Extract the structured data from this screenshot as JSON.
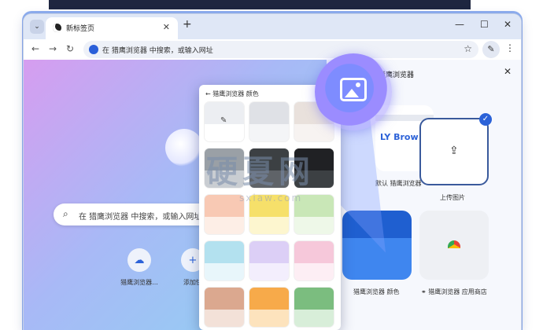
{
  "tab": {
    "title": "新标签页",
    "close": "✕",
    "new_tab": "+",
    "menu": "⌄"
  },
  "window_controls": {
    "minimize": "—",
    "maximize": "☐",
    "close": "✕"
  },
  "toolbar": {
    "back": "←",
    "forward": "→",
    "reload": "↻",
    "star": "☆",
    "kebab": "⋮",
    "pen": "✎"
  },
  "omnibox": {
    "text": "在 猎鹰浏览器 中搜索，或输入网址"
  },
  "ntp": {
    "search_text": "在 猎鹰浏览器 中搜索，或输入网址",
    "search_icon": "⌕",
    "shortcuts": [
      {
        "label": "猎鹰浏览器...",
        "icon": "☁"
      },
      {
        "label": "添加快",
        "icon": "+"
      }
    ]
  },
  "customize_panel": {
    "title": "猎鹰浏览器",
    "close": "✕",
    "default_card_text": "LY Brow",
    "default_label": "默认 猎鹰浏览器",
    "upload_label": "上传图片",
    "upload_icon": "⇪",
    "check": "✓",
    "color_label": "猎鹰浏览器 颜色",
    "store_label": "猎鹰浏览器 应用商店",
    "store_icon": "⚭"
  },
  "color_popup": {
    "title": "← 猎鹰浏览器 颜色",
    "pen": "✎",
    "swatches": [
      {
        "top": "#eceef2",
        "bottom": "#ffffff",
        "pen": true
      },
      {
        "top": "#dfe1e6",
        "bottom": "#f4f5f7"
      },
      {
        "top": "#e9e1dc",
        "bottom": "#f7f3f1"
      },
      {
        "top": "#9aa0a6",
        "bottom": "#c9cdd2"
      },
      {
        "top": "#3c4043",
        "bottom": "#5f6368"
      },
      {
        "top": "#202124",
        "bottom": "#3c4043"
      },
      {
        "top": "#f8c9b4",
        "bottom": "#fdeee6"
      },
      {
        "top": "#f6e06a",
        "bottom": "#fdf6cf"
      },
      {
        "top": "#c9e7b7",
        "bottom": "#eef8e8"
      },
      {
        "top": "#b3e1ef",
        "bottom": "#e8f6fb"
      },
      {
        "top": "#dccff6",
        "bottom": "#f3eefd"
      },
      {
        "top": "#f6c8da",
        "bottom": "#fdeef4"
      },
      {
        "top": "#dba88f",
        "bottom": "#f3e1d8"
      },
      {
        "top": "#f7aa4a",
        "bottom": "#fde3bd"
      },
      {
        "top": "#7bbd7f",
        "bottom": "#d8eed9"
      }
    ]
  },
  "watermark": {
    "main": "硬夏网",
    "sub": "sxiaw.com"
  }
}
